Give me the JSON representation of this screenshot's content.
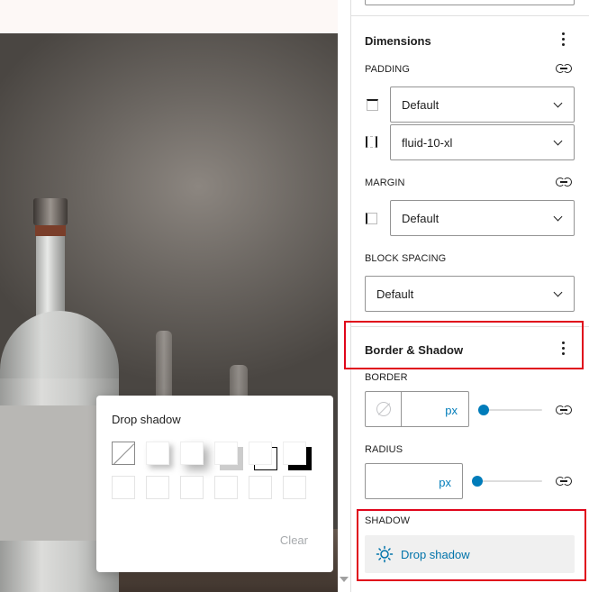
{
  "popover": {
    "title": "Drop shadow",
    "clear_label": "Clear",
    "swatches_row1": [
      "none",
      "natural",
      "deep",
      "sharp",
      "outlined",
      "crisp"
    ],
    "swatches_row2": [
      "empty",
      "empty",
      "empty",
      "empty",
      "empty",
      "empty"
    ]
  },
  "dimensions": {
    "title": "Dimensions",
    "padding_label": "PADDING",
    "padding_top_value": "Default",
    "padding_sides_value": "fluid-10-xl",
    "margin_label": "MARGIN",
    "margin_value": "Default",
    "block_spacing_label": "BLOCK SPACING",
    "block_spacing_value": "Default"
  },
  "border_shadow": {
    "title": "Border & Shadow",
    "border_label": "BORDER",
    "border_unit": "px",
    "radius_label": "RADIUS",
    "radius_unit": "px",
    "shadow_label": "SHADOW",
    "shadow_button_label": "Drop shadow"
  },
  "colors": {
    "accent": "#007cba",
    "highlight": "#e0061b",
    "shadow_btn_bg": "#f0f0f0"
  },
  "icons": {
    "kebab": "more-vertical-icon",
    "link": "link-icon",
    "chevron": "chevron-down-icon",
    "sun": "shadow-icon"
  }
}
